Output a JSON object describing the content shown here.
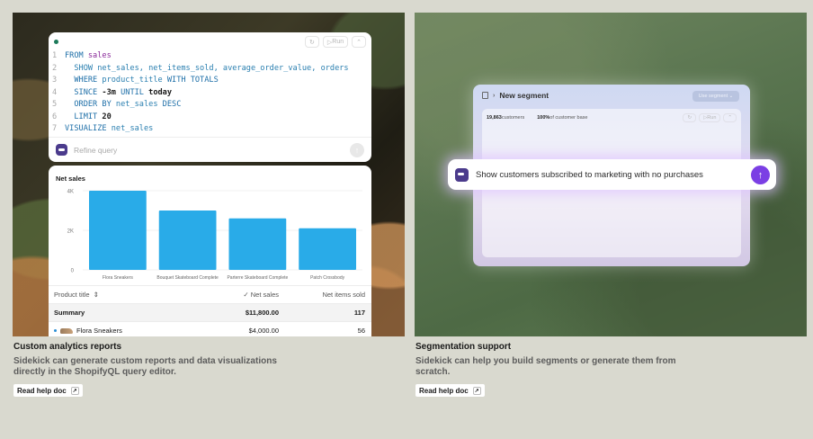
{
  "left": {
    "editor": {
      "run_label": "Run",
      "code": [
        {
          "n": "1",
          "parts": [
            [
              "kw",
              "FROM "
            ],
            [
              "val",
              "sales"
            ]
          ]
        },
        {
          "n": "2",
          "parts": [
            [
              "plain",
              "  SHOW net_sales, net_items_sold, average_order_value, orders"
            ]
          ]
        },
        {
          "n": "3",
          "parts": [
            [
              "kw",
              "  WHERE "
            ],
            [
              "plain",
              "product_title "
            ],
            [
              "kw",
              "WITH TOTALS"
            ]
          ]
        },
        {
          "n": "4",
          "parts": [
            [
              "kw",
              "  SINCE "
            ],
            [
              "num",
              "-3m "
            ],
            [
              "kw",
              "UNTIL "
            ],
            [
              "num",
              "today"
            ]
          ]
        },
        {
          "n": "5",
          "parts": [
            [
              "kw",
              "  ORDER BY "
            ],
            [
              "plain",
              "net_sales "
            ],
            [
              "kw",
              "DESC"
            ]
          ]
        },
        {
          "n": "6",
          "parts": [
            [
              "kw",
              "  LIMIT "
            ],
            [
              "num",
              "20"
            ]
          ]
        },
        {
          "n": "7",
          "parts": [
            [
              "kw",
              "VISUALIZE "
            ],
            [
              "plain",
              "net_sales"
            ]
          ]
        }
      ],
      "refine_placeholder": "Refine query"
    },
    "chart_title": "Net sales",
    "table": {
      "headers": [
        "Product title",
        "Net sales",
        "Net items sold"
      ],
      "summary": [
        "Summary",
        "$11,800.00",
        "117"
      ],
      "row1": [
        "Flora Sneakers",
        "$4,000.00",
        "56"
      ]
    },
    "caption_title": "Custom analytics reports",
    "caption_desc": "Sidekick can generate custom reports and data visualizations directly in the ShopifyQL query editor.",
    "help_label": "Read help doc"
  },
  "right": {
    "segment_title": "New segment",
    "segment_button": "Use segment",
    "customers_count": "19,863",
    "customers_label": "customers",
    "pct": "100%",
    "pct_label": "of customer base",
    "run_label": "Run",
    "prompt": "Show customers subscribed to marketing with no purchases",
    "caption_title": "Segmentation support",
    "caption_desc": "Sidekick can help you build segments or generate them from scratch.",
    "help_label": "Read help doc"
  },
  "colors": {
    "bar": "#29abe8",
    "accent": "#7b3fe4"
  },
  "chart_data": {
    "type": "bar",
    "title": "Net sales",
    "categories": [
      "Flora Sneakers",
      "Bouquet Skateboard Complete",
      "Parterre Skateboard Complete",
      "Patch Crossbody"
    ],
    "values": [
      4000,
      3000,
      2600,
      2100
    ],
    "ylim": [
      0,
      4000
    ],
    "yticks": [
      0,
      2000,
      4000
    ],
    "ytick_labels": [
      "0",
      "2K",
      "4K"
    ],
    "grid": true,
    "xlabel": "",
    "ylabel": ""
  }
}
